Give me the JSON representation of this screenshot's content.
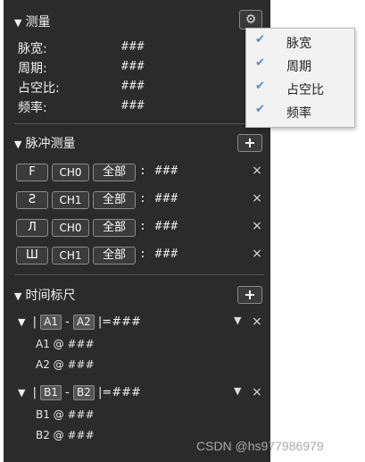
{
  "measure": {
    "title": "测量",
    "rows": [
      {
        "label": "脉宽:",
        "value": "###"
      },
      {
        "label": "周期:",
        "value": "###"
      },
      {
        "label": "占空比:",
        "value": "###"
      },
      {
        "label": "频率:",
        "value": "###"
      }
    ]
  },
  "pulse": {
    "title": "脉冲测量",
    "add_label": "+",
    "rows": [
      {
        "wave": "F",
        "channel": "CH0",
        "scope": "全部",
        "value": ": ###",
        "remove": "×"
      },
      {
        "wave": "Ƨ",
        "channel": "CH1",
        "scope": "全部",
        "value": ": ###",
        "remove": "×"
      },
      {
        "wave": "Л",
        "channel": "CH0",
        "scope": "全部",
        "value": ": ###",
        "remove": "×"
      },
      {
        "wave": "Ш",
        "channel": "CH1",
        "scope": "全部",
        "value": ": ###",
        "remove": "×"
      }
    ]
  },
  "timeline": {
    "title": "时间标尺",
    "add_label": "+",
    "cursors": [
      {
        "a": "A1",
        "b": "A2",
        "diff": "|=###",
        "line1": "A1 @ ###",
        "line2": "A2 @ ###",
        "remove": "×"
      },
      {
        "a": "B1",
        "b": "B2",
        "diff": "|=###",
        "line1": "B1 @ ###",
        "line2": "B2 @ ###",
        "remove": "×"
      }
    ]
  },
  "menu": {
    "items": [
      {
        "label": "脉宽",
        "checked": true
      },
      {
        "label": "周期",
        "checked": true
      },
      {
        "label": "占空比",
        "checked": true
      },
      {
        "label": "频率",
        "checked": true
      }
    ]
  },
  "watermark": "CSDN @hs977986979",
  "colors": {
    "panel": "#2b2b2b",
    "menu_bg": "#f2f2f2",
    "check": "#4a88d6"
  }
}
